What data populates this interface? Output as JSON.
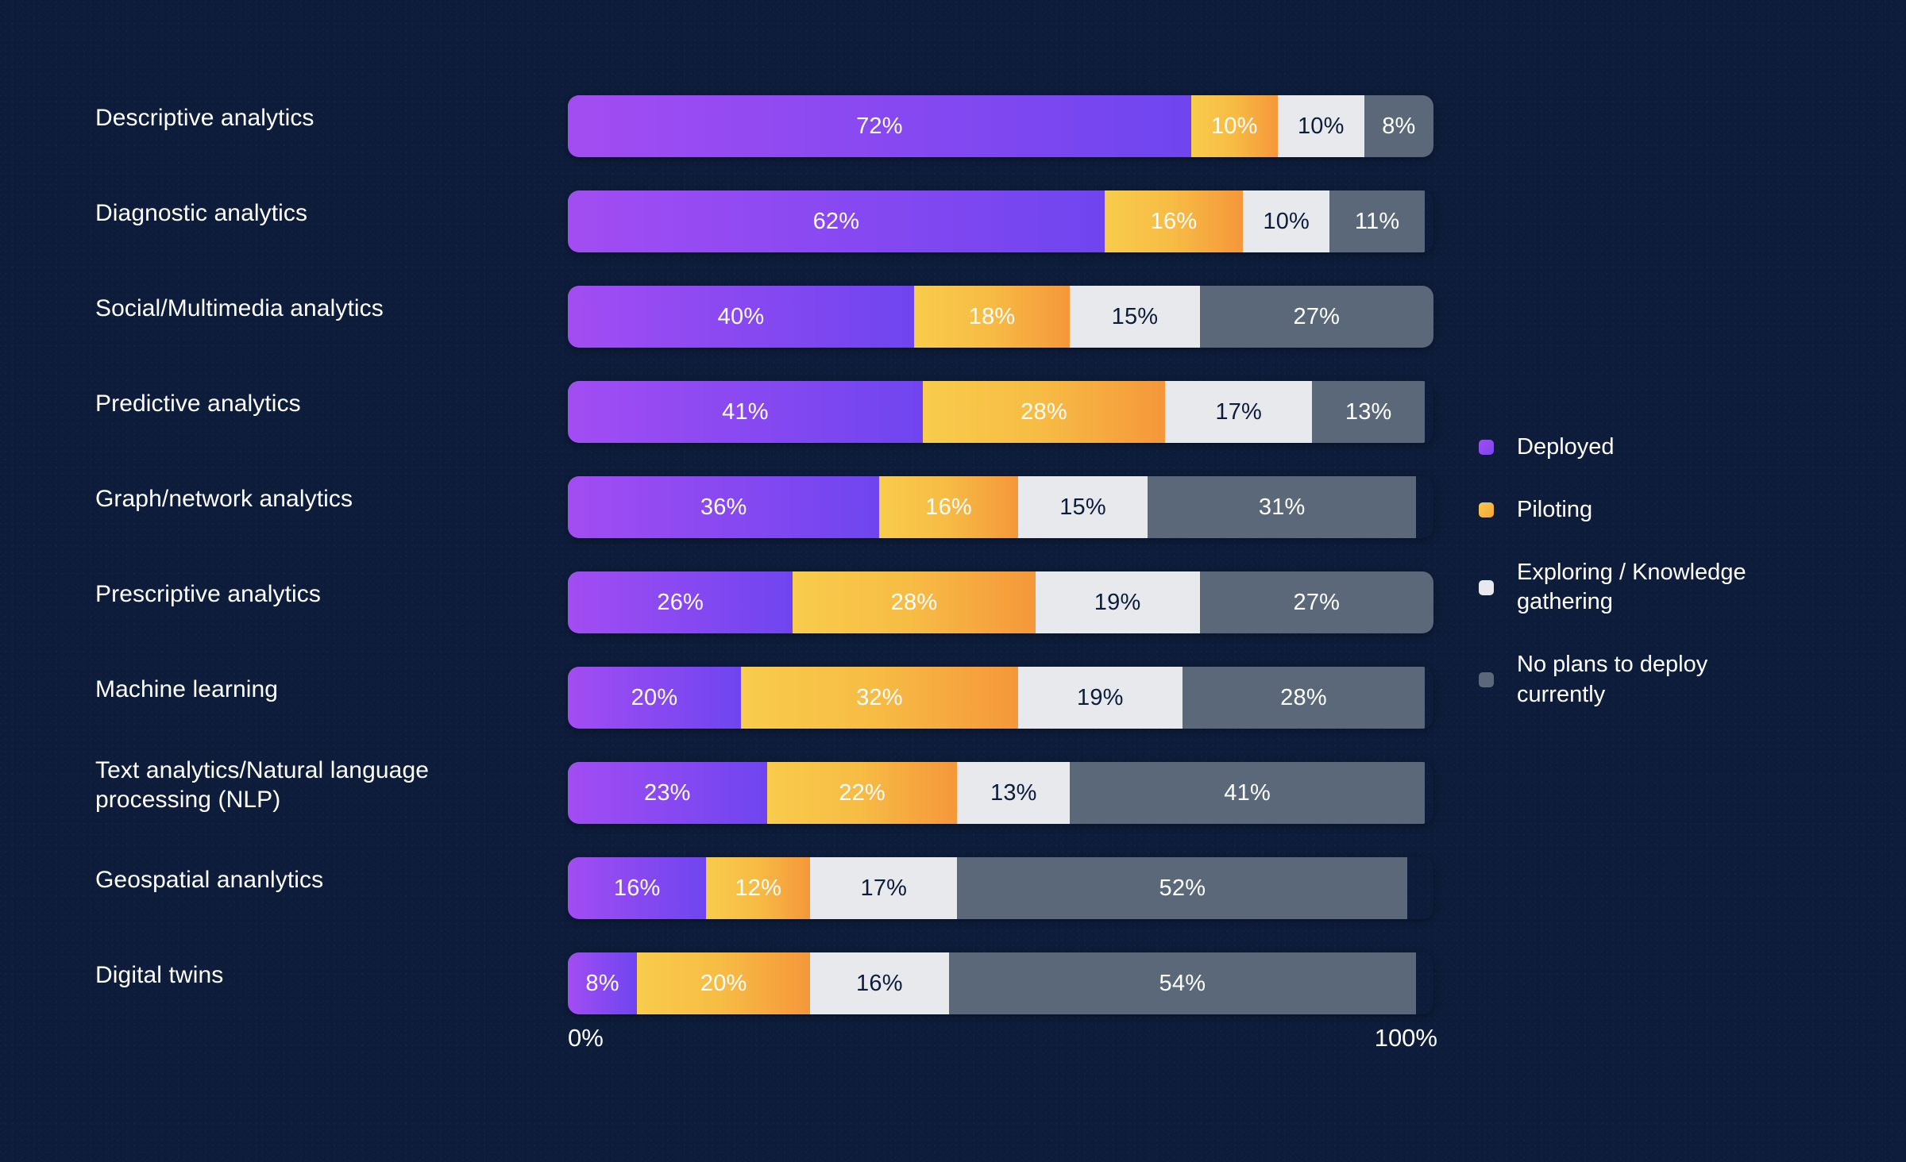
{
  "chart_data": {
    "type": "bar",
    "subtype": "stacked-horizontal-100",
    "title": "",
    "xlabel": "",
    "ylabel": "",
    "xlim": [
      0,
      100
    ],
    "axis_ticks": [
      "0%",
      "100%"
    ],
    "grid": false,
    "legend_position": "right",
    "unit": "%",
    "categories": [
      "Descriptive analytics",
      "Diagnostic analytics",
      "Social/Multimedia analytics",
      "Predictive analytics",
      "Graph/network analytics",
      "Prescriptive analytics",
      "Machine learning",
      "Text analytics/Natural language\nprocessing (NLP)",
      "Geospatial ananlytics",
      "Digital twins"
    ],
    "series": [
      {
        "name": "Deployed",
        "color": "#8b49f1",
        "values": [
          72,
          62,
          40,
          41,
          36,
          26,
          20,
          23,
          16,
          8
        ],
        "labels": [
          "72%",
          "62%",
          "40%",
          "41%",
          "36%",
          "26%",
          "20%",
          "23%",
          "16%",
          "8%"
        ]
      },
      {
        "name": "Piloting",
        "color": "#f7bb44",
        "values": [
          10,
          16,
          18,
          28,
          16,
          28,
          32,
          22,
          12,
          20
        ],
        "labels": [
          "10%",
          "16%",
          "18%",
          "28%",
          "16%",
          "28%",
          "32%",
          "22%",
          "12%",
          "20%"
        ]
      },
      {
        "name": "Exploring / Knowledge gathering",
        "color": "#e7e9ec",
        "values": [
          10,
          10,
          15,
          17,
          15,
          19,
          19,
          13,
          17,
          16
        ],
        "labels": [
          "10%",
          "10%",
          "15%",
          "17%",
          "15%",
          "19%",
          "19%",
          "13%",
          "17%",
          "16%"
        ]
      },
      {
        "name": "No plans to deploy currently",
        "color": "#5a6879",
        "values": [
          8,
          11,
          27,
          13,
          31,
          27,
          28,
          41,
          52,
          54
        ],
        "labels": [
          "8%",
          "11%",
          "27%",
          "13%",
          "31%",
          "27%",
          "28%",
          "41%",
          "52%",
          "54%"
        ]
      }
    ]
  },
  "legend": {
    "items": [
      {
        "label": "Deployed",
        "swatch": "deployed"
      },
      {
        "label": "Piloting",
        "swatch": "piloting"
      },
      {
        "label": "Exploring / Knowledge\ngathering",
        "swatch": "exploring"
      },
      {
        "label": "No plans to deploy\ncurrently",
        "swatch": "noplans"
      }
    ]
  },
  "axis": {
    "left": "0%",
    "right": "100%"
  },
  "colors": {
    "background": "#0d1c3a",
    "deployed_start": "#a24df2",
    "deployed_end": "#6f45f0",
    "piloting_start": "#f8cc4c",
    "piloting_end": "#f5973a",
    "exploring": "#e7e9ec",
    "noplans": "#5a6879",
    "text_light": "#ffffff",
    "text_dark": "#0d1c3a"
  }
}
